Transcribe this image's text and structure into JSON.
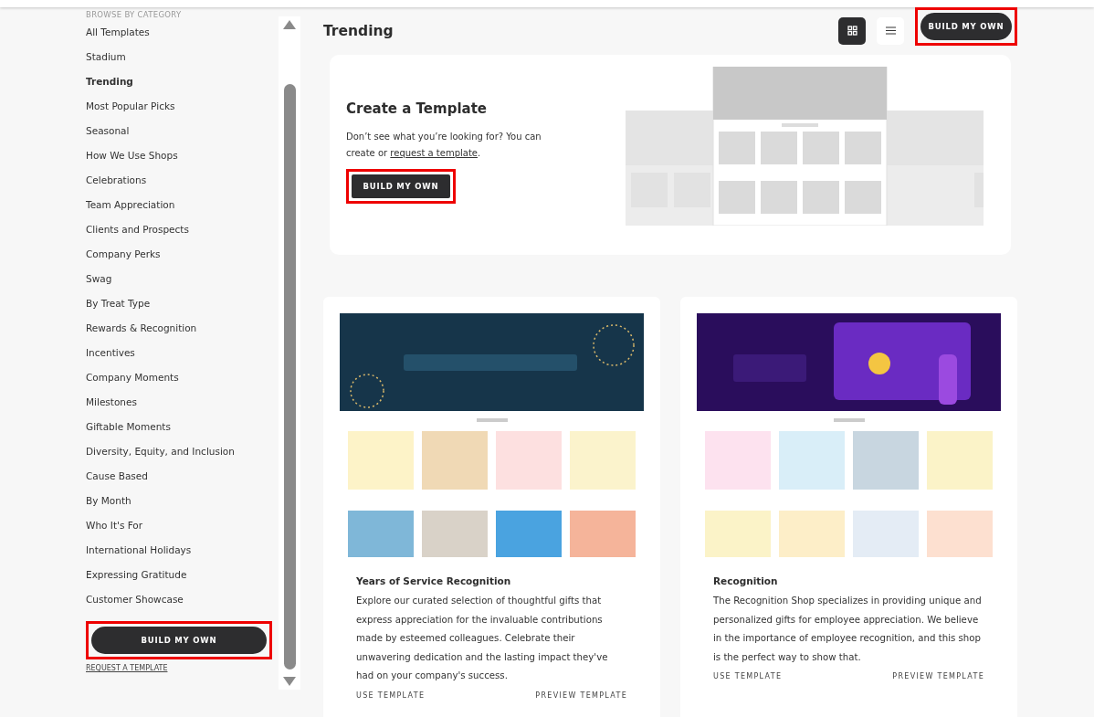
{
  "sidebar": {
    "heading": "BROWSE BY CATEGORY",
    "items": [
      {
        "label": "All Templates",
        "selected": false
      },
      {
        "label": "Stadium",
        "selected": false
      },
      {
        "label": "Trending",
        "selected": true
      },
      {
        "label": "Most Popular Picks",
        "selected": false
      },
      {
        "label": "Seasonal",
        "selected": false
      },
      {
        "label": "How We Use Shops",
        "selected": false
      },
      {
        "label": "Celebrations",
        "selected": false
      },
      {
        "label": "Team Appreciation",
        "selected": false
      },
      {
        "label": "Clients and Prospects",
        "selected": false
      },
      {
        "label": "Company Perks",
        "selected": false
      },
      {
        "label": "Swag",
        "selected": false
      },
      {
        "label": "By Treat Type",
        "selected": false
      },
      {
        "label": "Rewards & Recognition",
        "selected": false
      },
      {
        "label": "Incentives",
        "selected": false
      },
      {
        "label": "Company Moments",
        "selected": false
      },
      {
        "label": "Milestones",
        "selected": false
      },
      {
        "label": "Giftable Moments",
        "selected": false
      },
      {
        "label": "Diversity, Equity, and Inclusion",
        "selected": false
      },
      {
        "label": "Cause Based",
        "selected": false
      },
      {
        "label": "By Month",
        "selected": false
      },
      {
        "label": "Who It's For",
        "selected": false
      },
      {
        "label": "International Holidays",
        "selected": false
      },
      {
        "label": "Expressing Gratitude",
        "selected": false
      },
      {
        "label": "Customer Showcase",
        "selected": false
      }
    ],
    "build_button": {
      "label": "BUILD MY OWN",
      "highlighted": true
    },
    "request_link": "REQUEST A TEMPLATE"
  },
  "header": {
    "title": "Trending",
    "views": [
      {
        "kind": "grid",
        "selected": true
      },
      {
        "kind": "list",
        "selected": false
      }
    ],
    "build_button": {
      "label": "BUILD MY OWN",
      "highlighted": true
    }
  },
  "create_card": {
    "title": "Create a Template",
    "text_before": "Don’t see what you’re looking for? You can create or ",
    "link": "request a template",
    "text_after": ".",
    "build_button": {
      "label": "BUILD MY OWN",
      "highlighted": true
    }
  },
  "templates": [
    {
      "title": "Years of Service Recognition",
      "description": "Explore our curated selection of thoughtful gifts that express appreciation for the invaluable contributions made by esteemed colleagues. Celebrate their unwavering dedication and the lasting impact they've had on your company's success.",
      "use": "USE TEMPLATE",
      "preview": "PREVIEW TEMPLATE"
    },
    {
      "title": "Recognition",
      "description": "The Recognition Shop specializes in providing unique and personalized gifts for employee appreciation. We believe in the importance of employee recognition, and this shop is the perfect way to show that.",
      "use": "USE TEMPLATE",
      "preview": "PREVIEW TEMPLATE"
    }
  ]
}
